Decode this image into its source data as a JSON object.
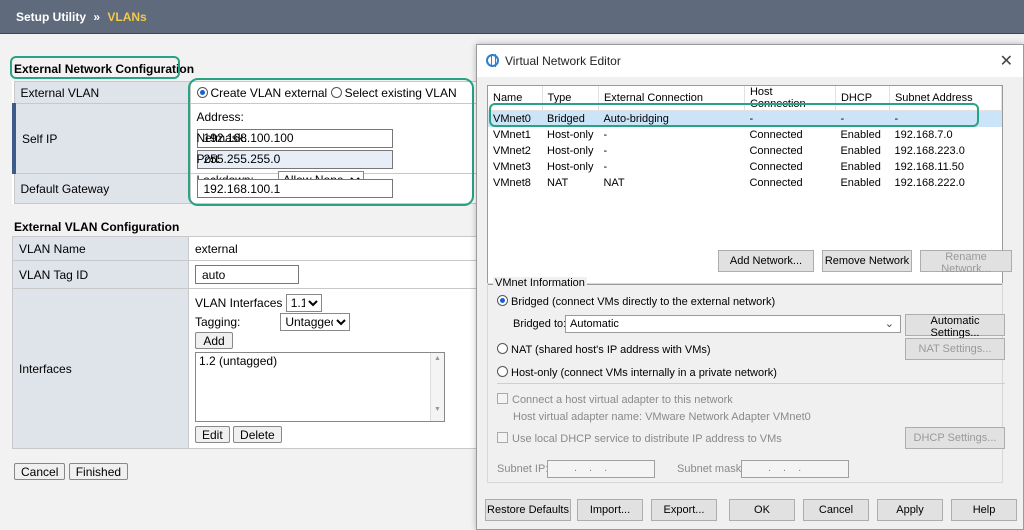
{
  "breadcrumb": {
    "root": "Setup Utility",
    "separator": "»",
    "current": "VLANs"
  },
  "ext_net": {
    "title": "External Network Configuration",
    "external_vlan_label": "External VLAN",
    "create_option": "Create VLAN external",
    "select_option": "Select existing VLAN",
    "self_ip_label": "Self IP",
    "address_label": "Address:",
    "address_value": "192.168.100.100",
    "netmask_label": "Netmask:",
    "netmask_value": "255.255.255.0",
    "port_lockdown_label": "Port Lockdown:",
    "port_lockdown_value": "Allow None",
    "default_gateway_label": "Default Gateway",
    "default_gateway_value": "192.168.100.1"
  },
  "ext_vlan": {
    "title": "External VLAN Configuration",
    "vlan_name_label": "VLAN Name",
    "vlan_name_value": "external",
    "vlan_tag_label": "VLAN Tag ID",
    "vlan_tag_value": "auto",
    "interfaces_label": "Interfaces",
    "vlan_interfaces_label": "VLAN Interfaces",
    "vlan_interfaces_value": "1.1",
    "tagging_label": "Tagging:",
    "tagging_value": "Untagged",
    "add_label": "Add",
    "list_item": "1.2 (untagged)",
    "edit_label": "Edit",
    "delete_label": "Delete"
  },
  "footer": {
    "cancel": "Cancel",
    "finished": "Finished"
  },
  "vne": {
    "title": "Virtual Network Editor",
    "columns": [
      "Name",
      "Type",
      "External Connection",
      "Host Connection",
      "DHCP",
      "Subnet Address"
    ],
    "rows": [
      [
        "VMnet0",
        "Bridged",
        "Auto-bridging",
        "-",
        "-",
        "-"
      ],
      [
        "VMnet1",
        "Host-only",
        "-",
        "Connected",
        "Enabled",
        "192.168.7.0"
      ],
      [
        "VMnet2",
        "Host-only",
        "-",
        "Connected",
        "Enabled",
        "192.168.223.0"
      ],
      [
        "VMnet3",
        "Host-only",
        "-",
        "Connected",
        "Enabled",
        "192.168.11.50"
      ],
      [
        "VMnet8",
        "NAT",
        "NAT",
        "Connected",
        "Enabled",
        "192.168.222.0"
      ]
    ],
    "add_network": "Add Network...",
    "remove_network": "Remove Network",
    "rename_network": "Rename Network...",
    "info_title": "VMnet Information",
    "bridged_option": "Bridged (connect VMs directly to the external network)",
    "bridged_to_label": "Bridged to:",
    "bridged_to_value": "Automatic",
    "automatic_settings": "Automatic Settings...",
    "nat_option": "NAT (shared host's IP address with VMs)",
    "nat_settings": "NAT Settings...",
    "hostonly_option": "Host-only (connect VMs internally in a private network)",
    "connect_adapter": "Connect a host virtual adapter to this network",
    "adapter_name": "Host virtual adapter name: VMware Network Adapter VMnet0",
    "use_dhcp": "Use local DHCP service to distribute IP address to VMs",
    "dhcp_settings": "DHCP Settings...",
    "subnet_ip_label": "Subnet IP:",
    "subnet_ip_value": "...",
    "subnet_mask_label": "Subnet mask:",
    "subnet_mask_value": "...",
    "restore_defaults": "Restore Defaults",
    "import": "Import...",
    "export": "Export...",
    "ok": "OK",
    "cancel": "Cancel",
    "apply": "Apply",
    "help": "Help"
  },
  "colors": {
    "accent_green": "#2aa383",
    "topbar": "#5f6a7c",
    "breadcrumb_current": "#f2c94c"
  }
}
